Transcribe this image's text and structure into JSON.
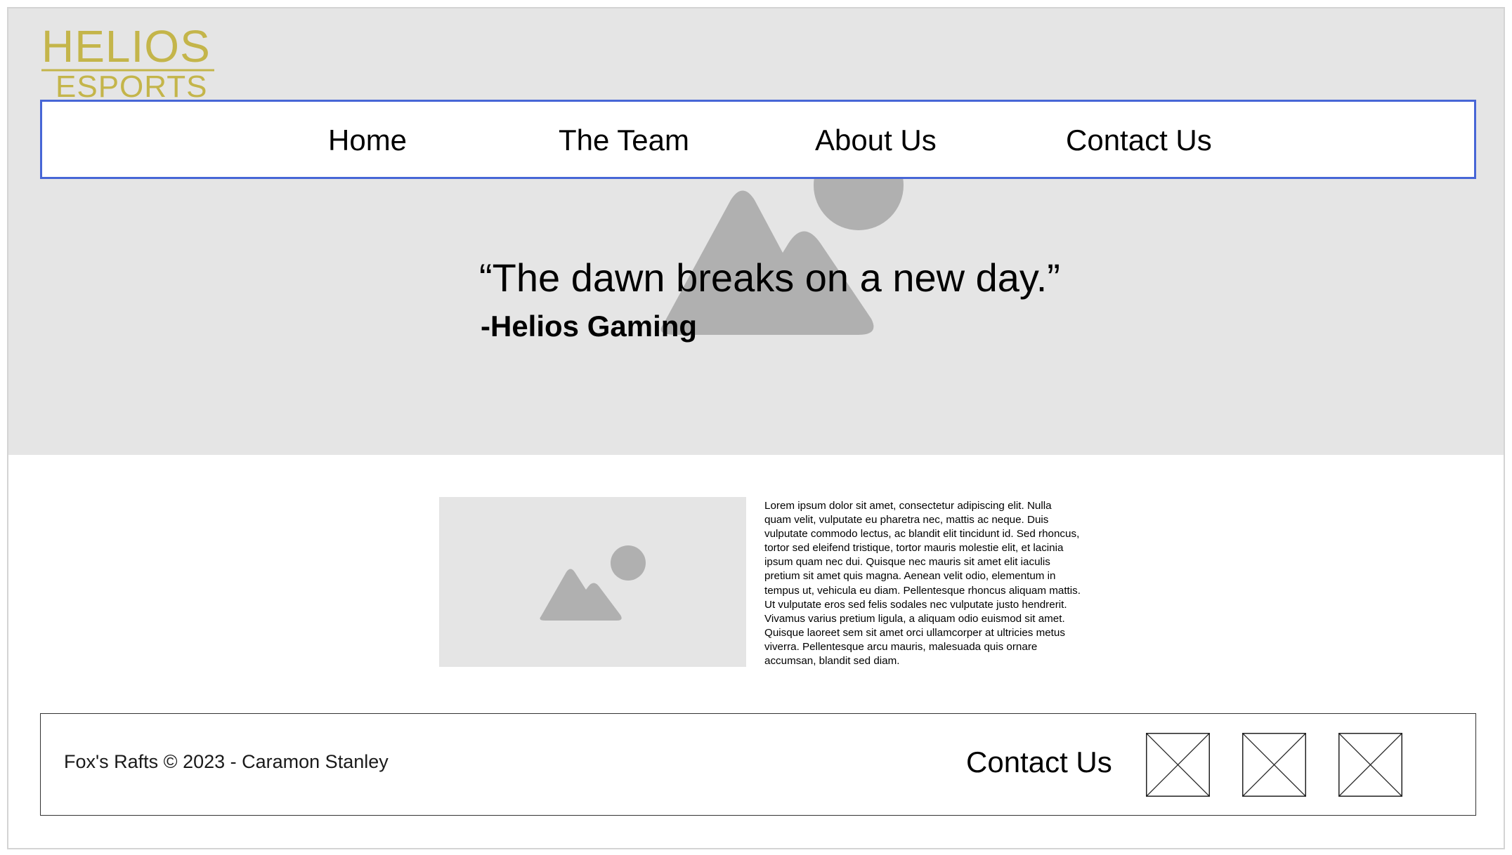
{
  "brand": {
    "logo_line1": "HELIOS",
    "logo_line2": "ESPORTS",
    "color": "#c4b54a"
  },
  "nav": {
    "items": [
      {
        "label": "Home"
      },
      {
        "label": "The Team"
      },
      {
        "label": "About Us"
      },
      {
        "label": "Contact Us"
      }
    ],
    "border_color": "#4766d6"
  },
  "hero": {
    "quote": "“The dawn breaks on a new day.”",
    "author": "-Helios Gaming",
    "background": "#e5e5e5",
    "image_icon": "image-placeholder-icon"
  },
  "content": {
    "image_icon": "image-placeholder-icon",
    "text": "Lorem ipsum dolor sit amet, consectetur adipiscing elit. Nulla quam velit, vulputate eu pharetra nec, mattis ac neque. Duis vulputate commodo lectus, ac blandit elit tincidunt id. Sed rhoncus, tortor sed eleifend tristique, tortor mauris molestie elit, et lacinia ipsum quam nec dui. Quisque nec mauris sit amet elit iaculis pretium sit amet quis magna. Aenean velit odio, elementum in tempus ut, vehicula eu diam. Pellentesque rhoncus aliquam mattis. Ut vulputate eros sed felis sodales nec vulputate justo hendrerit. Vivamus varius pretium ligula, a aliquam odio euismod sit amet. Quisque laoreet sem sit amet orci ullamcorper at ultricies metus viverra. Pellentesque arcu mauris, malesuada quis ornare accumsan, blandit sed diam."
  },
  "footer": {
    "copyright": "Fox's Rafts © 2023 - Caramon Stanley",
    "contact_label": "Contact Us",
    "social_icons": [
      "social-icon-placeholder",
      "social-icon-placeholder",
      "social-icon-placeholder"
    ]
  },
  "colors": {
    "placeholder_shape": "#b0b0b0",
    "placeholder_bg": "#e5e5e5"
  }
}
